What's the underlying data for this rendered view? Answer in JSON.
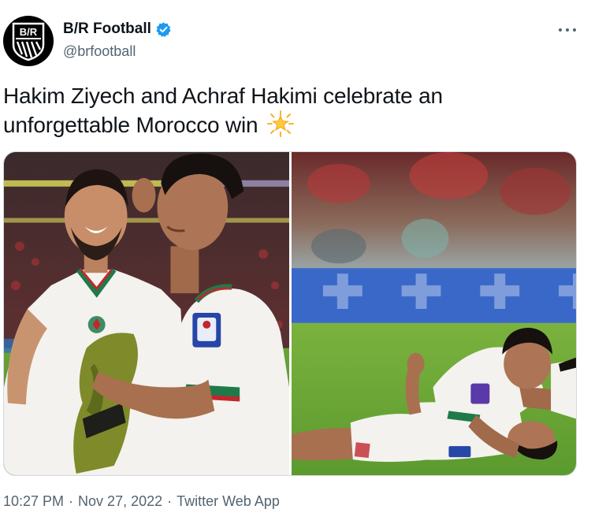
{
  "account": {
    "display_name": "B/R Football",
    "handle": "@brfootball",
    "avatar_text": "B/R",
    "verified": true,
    "verified_color": "#1d9bf0"
  },
  "tweet": {
    "text": "Hakim Ziyech and Achraf Hakimi celebrate an unforgettable Morocco win",
    "emoji": "glowing-star-emoji"
  },
  "meta": {
    "time": "10:27 PM",
    "date": "Nov 27, 2022",
    "source": "Twitter Web App",
    "separator": "·"
  },
  "media": [
    {
      "name": "photo-players-celebrating-standing"
    },
    {
      "name": "photo-players-lying-on-pitch"
    }
  ],
  "colors": {
    "text_primary": "#0f1419",
    "text_secondary": "#536471",
    "accent": "#1d9bf0",
    "jersey_white": "#f4f2ee",
    "jersey_green": "#1f7a4a",
    "jersey_red": "#c1272d",
    "pitch": "#4f8e2e"
  }
}
